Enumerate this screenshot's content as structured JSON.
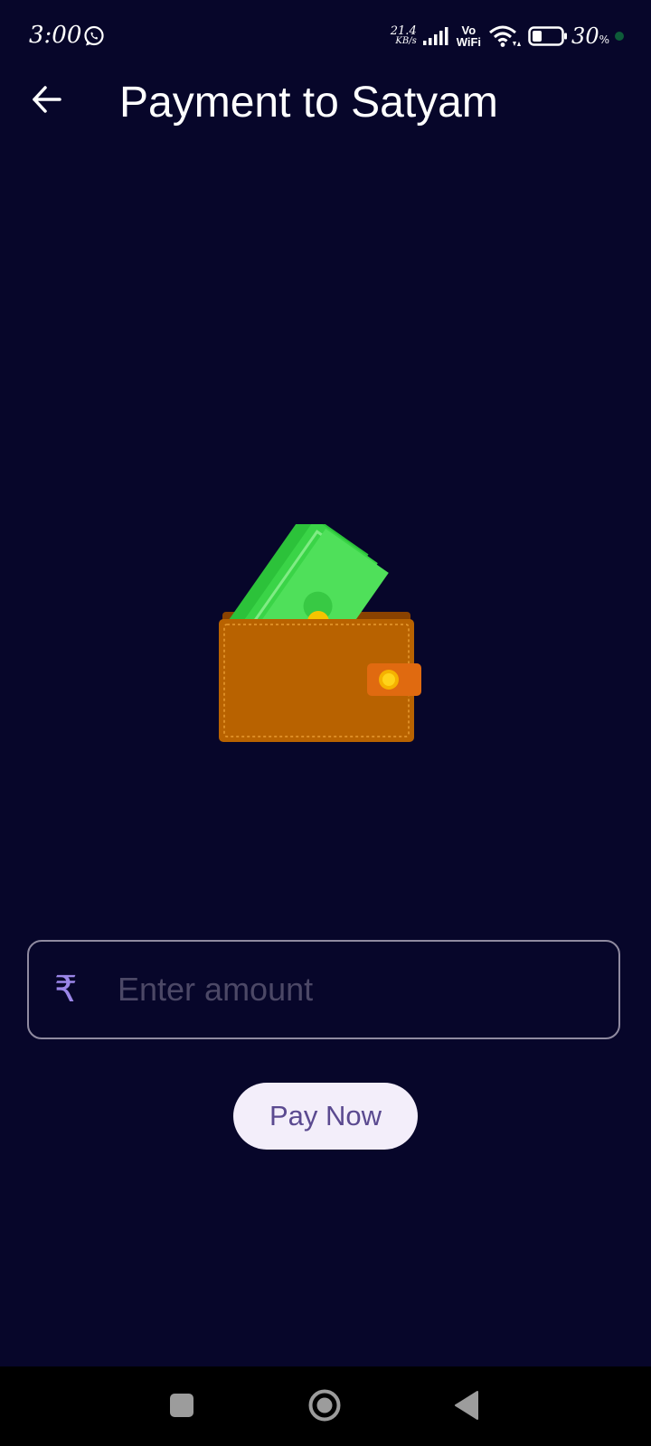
{
  "status_bar": {
    "time": "3:00",
    "net_speed_value": "21.4",
    "net_speed_unit": "KB/s",
    "vowifi_top": "Vo",
    "vowifi_bottom": "WiFi",
    "battery_percent": "30",
    "battery_percent_sign": "%",
    "icons": [
      "whatsapp-icon",
      "signal-icon",
      "wifi-icon",
      "battery-icon"
    ]
  },
  "header": {
    "back_icon": "arrow-left-icon",
    "title": "Payment to Satyam"
  },
  "illustration": {
    "icon": "wallet-with-cash-icon"
  },
  "amount_field": {
    "currency_symbol": "₹",
    "value": "",
    "placeholder": "Enter amount"
  },
  "pay_button": {
    "label": "Pay Now"
  },
  "nav_bar": {
    "icons": [
      "recents-square-icon",
      "home-circle-icon",
      "back-triangle-icon"
    ]
  },
  "colors": {
    "background": "#07062a",
    "accent": "#9b86e8",
    "button_background": "#f3eefa",
    "button_text": "#5b4a90",
    "wallet": "#b86200",
    "cash": "#47d847"
  }
}
